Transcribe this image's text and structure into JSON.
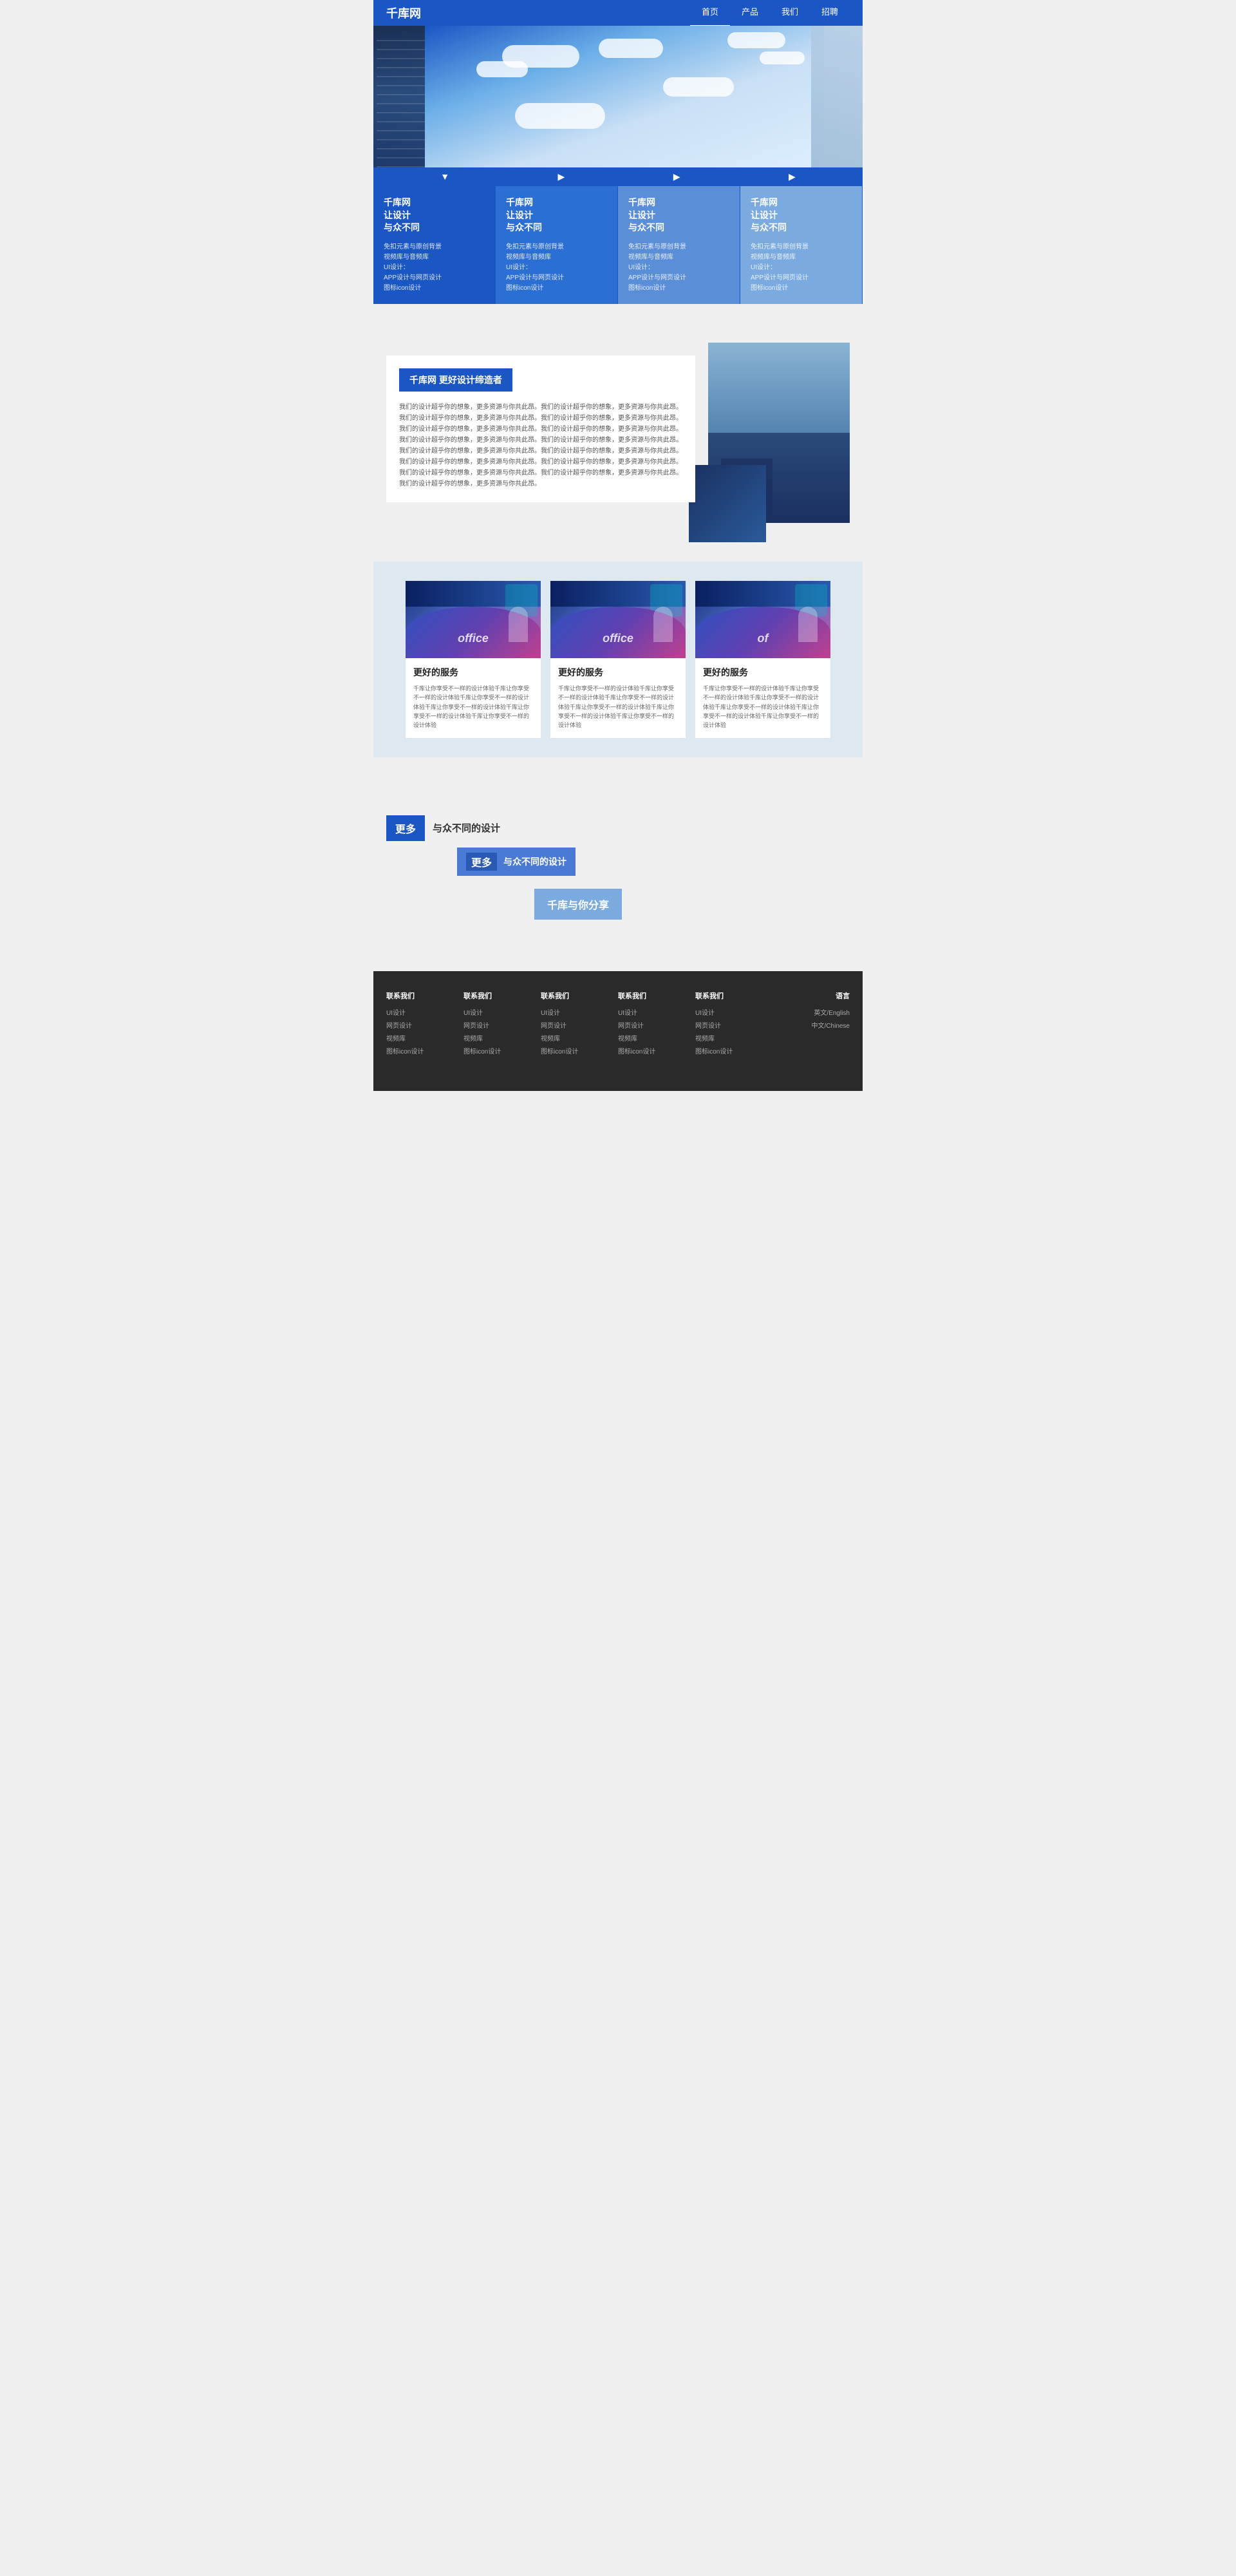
{
  "nav": {
    "logo": "千库网",
    "links": [
      {
        "label": "首页",
        "active": true
      },
      {
        "label": "产品",
        "active": false
      },
      {
        "label": "我们",
        "active": false
      },
      {
        "label": "招聘",
        "active": false
      }
    ]
  },
  "features": {
    "cards": [
      {
        "title": "千库网\n让设计\n与众不同",
        "desc": "免扣元素与原创背景\n视频库与音频库\nUI设计：\nAPP设计与网页设计\n图标icon设计"
      },
      {
        "title": "千库网\n让设计\n与众不同",
        "desc": "免扣元素与原创背景\n视频库与音频库\nUI设计：\nAPP设计与网页设计\n图标icon设计"
      },
      {
        "title": "千库网\n让设计\n与众不同",
        "desc": "免扣元素与原创背景\n视频库与音频库\nUI设计：\nAPP设计与网页设计\n图标icon设计"
      },
      {
        "title": "千库网\n让设计\n与众不同",
        "desc": "免扣元素与原创背景\n视频库与音频库\nUI设计：\nAPP设计与网页设计\n图标icon设计"
      }
    ]
  },
  "about": {
    "title": "千库网  更好设计缔造者",
    "text": "我们的设计超乎你的想象，更多资源与你共此昂。我们的设计超乎你的想象，更多资源与你共此昂。我们的设计超乎你的想象，更多资源与你共此昂。我们的设计超乎你的想象，更多资源与你共此昂。我们的设计超乎你的想象，更多资源与你共此昂。我们的设计超乎你的想象，更多资源与你共此昂。我们的设计超乎你的想象，更多资源与你共此昂。我们的设计超乎你的想象，更多资源与你共此昂。我们的设计超乎你的想象，更多资源与你共此昂。我们的设计超乎你的想象，更多资源与你共此昂。我们的设计超乎你的想象，更多资源与你共此昂。我们的设计超乎你的想象，更多资源与你共此昂。我们的设计超乎你的想象，更多资源与你共此昂。我们的设计超乎你的想象，更多资源与你共此昂。我们的设计超乎你的想象，更多资源与你共此昂。"
  },
  "services": {
    "cards": [
      {
        "office_text": "office",
        "title": "更好的服务",
        "desc": "千库让你享受不一样的设计体验千库让你享受不一样的设计体验千库让你享受不一样的设计体验千库让你享受不一样的设计体验千库让你享受不一样的设计体验千库让你享受不一样的设计体验"
      },
      {
        "office_text": "office",
        "title": "更好的服务",
        "desc": "千库让你享受不一样的设计体验千库让你享受不一样的设计体验千库让你享受不一样的设计体验千库让你享受不一样的设计体验千库让你享受不一样的设计体验千库让你享受不一样的设计体验"
      },
      {
        "office_text": "of",
        "title": "更好的服务",
        "desc": "千库让你享受不一样的设计体验千库让你享受不一样的设计体验千库让你享受不一样的设计体验千库让你享受不一样的设计体验千库让你享受不一样的设计体验千库让你享受不一样的设计体验"
      }
    ]
  },
  "more": {
    "row1_label": "更多",
    "row1_text": "与众不同的设计",
    "row2_label": "更多",
    "row2_text": "与众不同的设计",
    "row3_text": "千库与你分享"
  },
  "footer": {
    "columns": [
      {
        "title": "联系我们",
        "items": [
          "UI设计",
          "网页设计",
          "视频库",
          "图标icon设计"
        ]
      },
      {
        "title": "联系我们",
        "items": [
          "UI设计",
          "网页设计",
          "视频库",
          "图标icon设计"
        ]
      },
      {
        "title": "联系我们",
        "items": [
          "UI设计",
          "网页设计",
          "视频库",
          "图标icon设计"
        ]
      },
      {
        "title": "联系我们",
        "items": [
          "UI设计",
          "网页设计",
          "视频库",
          "图标icon设计"
        ]
      },
      {
        "title": "联系我们",
        "items": [
          "UI设计",
          "网页设计",
          "视频库",
          "图标icon设计"
        ]
      }
    ],
    "lang": {
      "title": "语言",
      "items": [
        "英文/English",
        "中文/Chinese"
      ]
    }
  }
}
